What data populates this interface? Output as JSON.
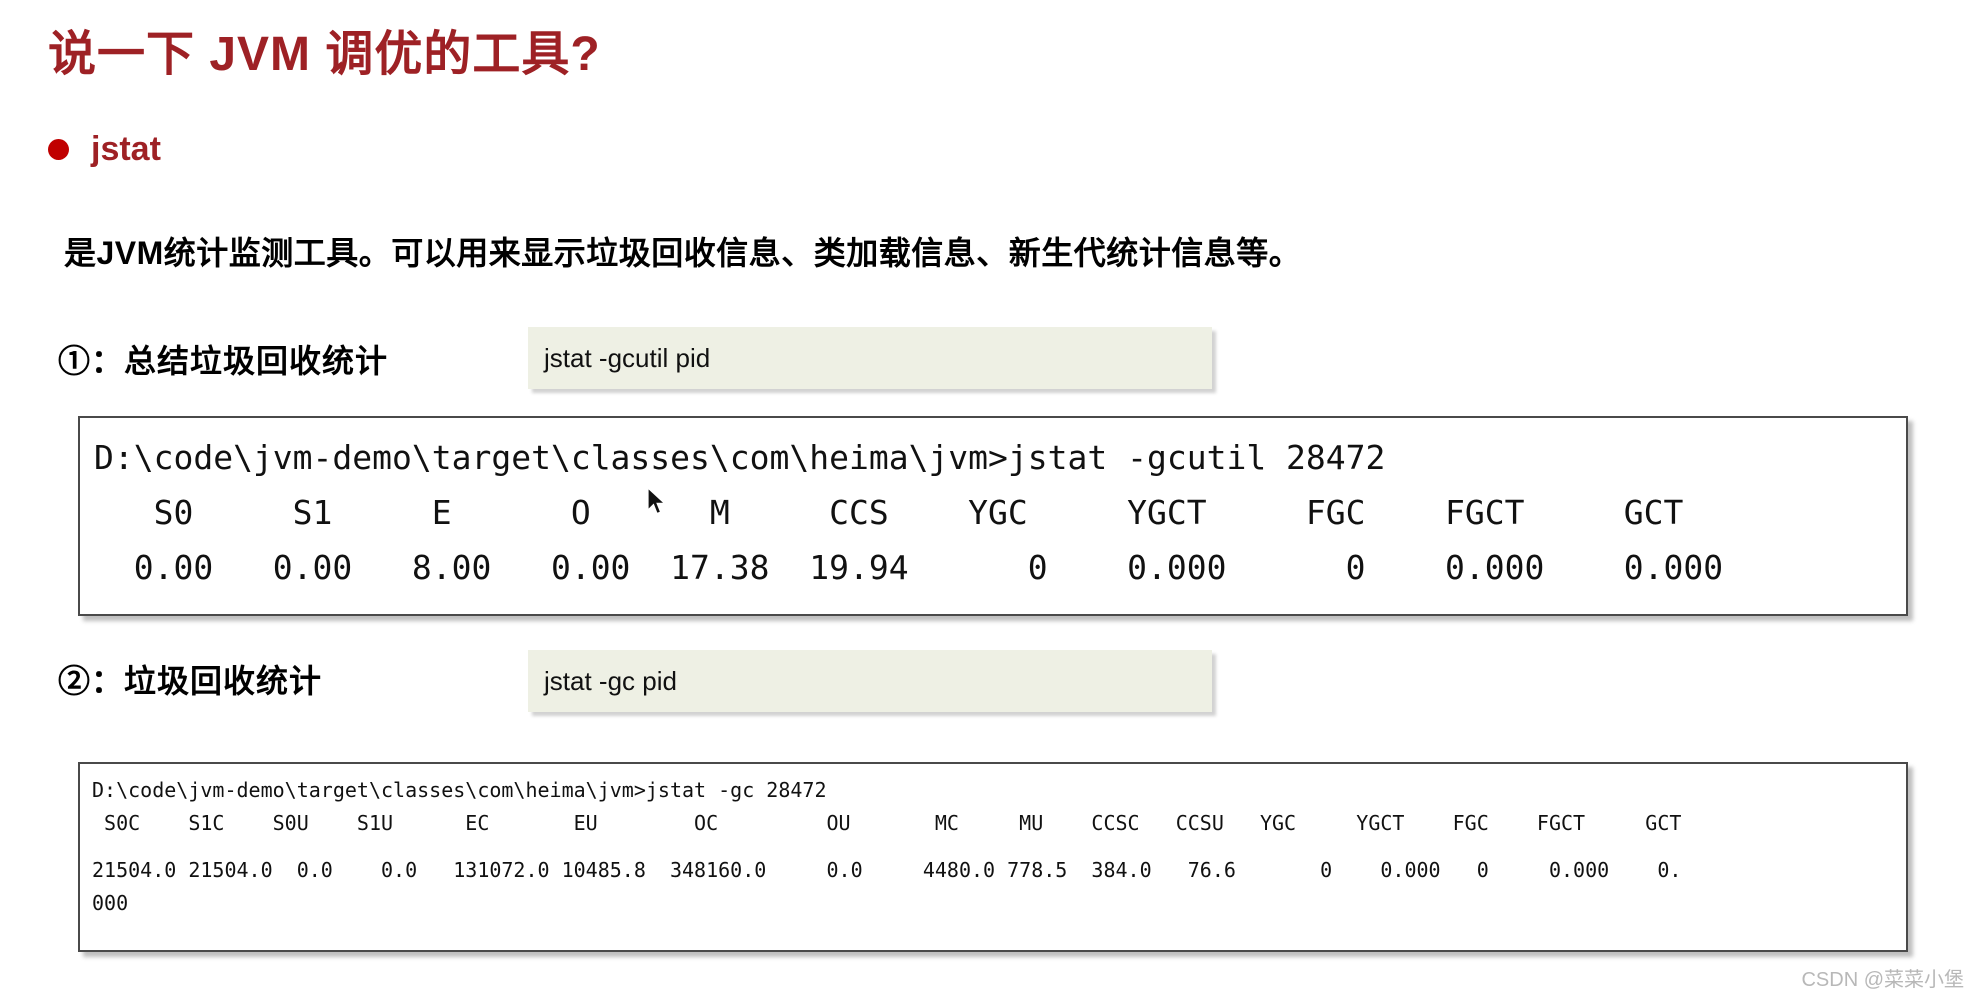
{
  "slide": {
    "title": "说一下 JVM 调优的工具?",
    "bullet": {
      "icon": "bullet-dot",
      "label": "jstat"
    },
    "description": "是JVM统计监测工具。可以用来显示垃圾回收信息、类加载信息、新生代统计信息等。",
    "sections": [
      {
        "label": "①：总结垃圾回收统计",
        "command": "jstat -gcutil pid",
        "terminal": {
          "prompt_line": "D:\\code\\jvm-demo\\target\\classes\\com\\heima\\jvm>jstat -gcutil 28472",
          "header_line": "   S0     S1     E      O      M     CCS    YGC     YGCT     FGC    FGCT     GCT",
          "data_line": "  0.00   0.00   8.00   0.00  17.38  19.94      0    0.000      0    0.000    0.000",
          "columns": [
            "S0",
            "S1",
            "E",
            "O",
            "M",
            "CCS",
            "YGC",
            "YGCT",
            "FGC",
            "FGCT",
            "GCT"
          ],
          "values": [
            "0.00",
            "0.00",
            "8.00",
            "0.00",
            "17.38",
            "19.94",
            "0",
            "0.000",
            "0",
            "0.000",
            "0.000"
          ]
        }
      },
      {
        "label": "②：垃圾回收统计",
        "command": "jstat -gc pid",
        "terminal": {
          "prompt_line": "D:\\code\\jvm-demo\\target\\classes\\com\\heima\\jvm>jstat -gc 28472",
          "header_line": " S0C    S1C    S0U    S1U      EC       EU        OC         OU       MC     MU    CCSC   CCSU   YGC     YGCT    FGC    FGCT     GCT",
          "data_line_1": "21504.0 21504.0  0.0    0.0   131072.0 10485.8  348160.0     0.0     4480.0 778.5  384.0   76.6       0    0.000   0     0.000    0.",
          "data_line_2": "000",
          "columns": [
            "S0C",
            "S1C",
            "S0U",
            "S1U",
            "EC",
            "EU",
            "OC",
            "OU",
            "MC",
            "MU",
            "CCSC",
            "CCSU",
            "YGC",
            "YGCT",
            "FGC",
            "FGCT",
            "GCT"
          ],
          "values": [
            "21504.0",
            "21504.0",
            "0.0",
            "0.0",
            "131072.0",
            "10485.8",
            "348160.0",
            "0.0",
            "4480.0",
            "778.5",
            "384.0",
            "76.6",
            "0",
            "0.000",
            "0",
            "0.000",
            "0.000"
          ]
        }
      }
    ],
    "cursor": "mouse-pointer",
    "watermark": "CSDN @菜菜小堡",
    "colors": {
      "title": "#9e2125",
      "bullet": "#c00000",
      "command_box_bg": "#eef0e4",
      "terminal_border": "#4a4a4a",
      "watermark": "#b8b8b8"
    }
  }
}
